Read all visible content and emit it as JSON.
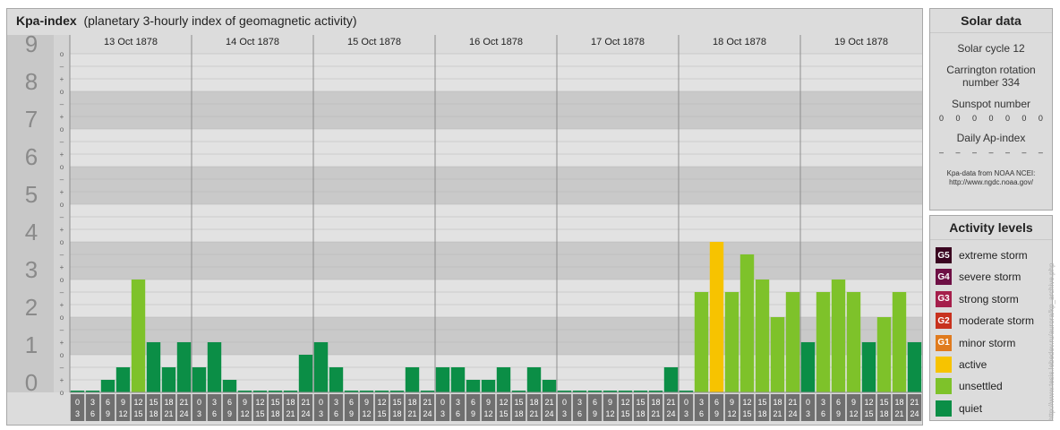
{
  "title": {
    "main": "Kpa-index",
    "sub": "(planetary 3-hourly index of geomagnetic activity)"
  },
  "chart_data": {
    "type": "bar",
    "title": "Kpa-index",
    "subtitle": "(planetary 3-hourly index of geomagnetic activity)",
    "ylim": [
      0,
      9
    ],
    "y_ticks": [
      "0",
      "1",
      "2",
      "3",
      "4",
      "5",
      "6",
      "7",
      "8",
      "9"
    ],
    "minor_tick_labels": [
      "o",
      "+",
      "–"
    ],
    "days": [
      "13 Oct 1878",
      "14 Oct 1878",
      "15 Oct 1878",
      "16 Oct 1878",
      "17 Oct 1878",
      "18 Oct 1878",
      "19 Oct 1878"
    ],
    "interval_labels": [
      [
        "0",
        "3"
      ],
      [
        "3",
        "6"
      ],
      [
        "6",
        "9"
      ],
      [
        "9",
        "12"
      ],
      [
        "12",
        "15"
      ],
      [
        "15",
        "18"
      ],
      [
        "18",
        "21"
      ],
      [
        "21",
        "24"
      ]
    ],
    "values": [
      [
        0,
        0,
        0.333,
        0.667,
        3,
        1.333,
        0.667,
        1.333
      ],
      [
        0.667,
        1.333,
        0.333,
        0,
        0,
        0,
        0,
        1
      ],
      [
        1.333,
        0.667,
        0,
        0,
        0,
        0,
        0.667,
        0
      ],
      [
        0.667,
        0.667,
        0.333,
        0.333,
        0.667,
        0,
        0.667,
        0.333
      ],
      [
        0,
        0,
        0,
        0,
        0,
        0,
        0,
        0.667
      ],
      [
        0,
        2.667,
        4,
        2.667,
        3.667,
        3,
        2,
        2.667
      ],
      [
        1.333,
        2.667,
        3,
        2.667,
        1.333,
        2,
        2.667,
        1.333
      ]
    ],
    "colors": {
      "quiet": "#0b8e46",
      "unsettled": "#7ec22a",
      "active": "#f7c300",
      "g1": "#e07b1e",
      "g2": "#c8321e",
      "g3": "#a51f4b",
      "g4": "#6e1045",
      "g5": "#3a0520"
    }
  },
  "solar": {
    "header": "Solar data",
    "cycle": "Solar cycle 12",
    "carrington": "Carrington rotation number 334",
    "sunspot_label": "Sunspot number",
    "sunspots": [
      "0",
      "0",
      "0",
      "0",
      "0",
      "0",
      "0"
    ],
    "ap_label": "Daily Ap-index",
    "ap_values": [
      "–",
      "–",
      "–",
      "–",
      "–",
      "–",
      "–"
    ],
    "note_line1": "Kpa-data from NOAA NCEI:",
    "note_line2": "http://www.ngdc.noaa.gov/"
  },
  "legend": {
    "header": "Activity levels",
    "items": [
      {
        "badge": "G5",
        "label": "extreme storm",
        "color": "#3a0520"
      },
      {
        "badge": "G4",
        "label": "severe storm",
        "color": "#6e1045"
      },
      {
        "badge": "G3",
        "label": "strong storm",
        "color": "#a51f4b"
      },
      {
        "badge": "G2",
        "label": "moderate storm",
        "color": "#c8321e"
      },
      {
        "badge": "G1",
        "label": "minor storm",
        "color": "#e07b1e"
      },
      {
        "badge": "",
        "label": "active",
        "color": "#f7c300"
      },
      {
        "badge": "",
        "label": "unsettled",
        "color": "#7ec22a"
      },
      {
        "badge": "",
        "label": "quiet",
        "color": "#0b8e46"
      }
    ]
  },
  "watermark": "http://www.tesis.lebedev.ru/aurora/kp_archive.php"
}
